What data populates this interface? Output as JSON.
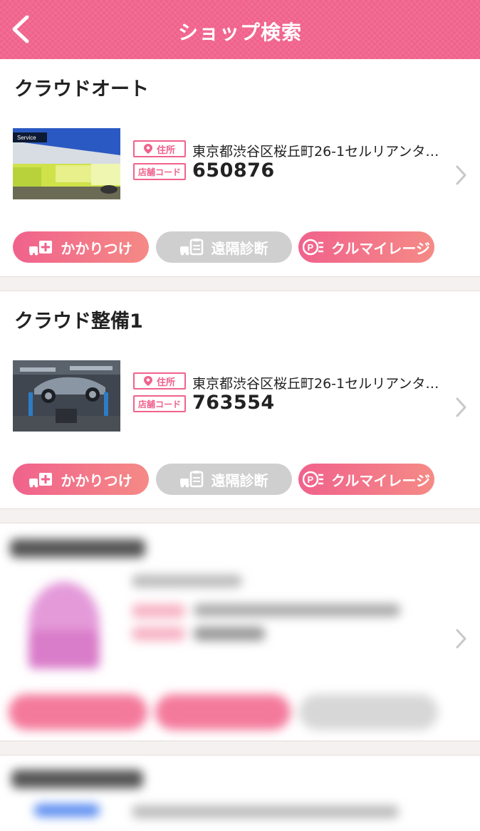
{
  "header": {
    "title": "ショップ検索",
    "back_icon": "chevron-left-icon",
    "background_color": "#f0628c"
  },
  "tags": {
    "address": "住所",
    "shop_code": "店舗コード"
  },
  "actions": {
    "kakaritsuke": "かかりつけ",
    "remote_diagnosis": "遠隔診断",
    "kurumileage": "クルマイレージ"
  },
  "shops": [
    {
      "name": "クラウドオート",
      "address": "東京都渋谷区桜丘町26-1セルリアンタ…",
      "code": "650876",
      "image": "service-garage-photo"
    },
    {
      "name": "クラウド整備1",
      "address": "東京都渋谷区桜丘町26-1セルリアンタ…",
      "code": "763554",
      "image": "car-lift-workshop-photo"
    }
  ],
  "colors": {
    "accent": "#f0628c",
    "accent_end": "#f58a86",
    "disabled": "#cfcfcf",
    "divider": "#f6f1f1"
  }
}
